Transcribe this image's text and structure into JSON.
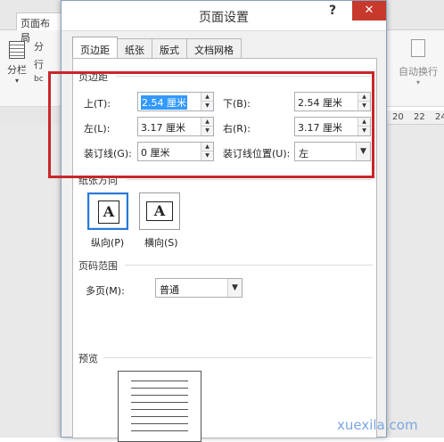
{
  "background": {
    "tab": "页面布局",
    "group1": "分栏",
    "group2_a": "分",
    "group2_b": "行",
    "group2_c": "bc",
    "right_group": "自动换行",
    "ruler": [
      "20",
      "22",
      "24"
    ]
  },
  "dialog": {
    "title": "页面设置",
    "help": "?",
    "close": "✕",
    "tabs": [
      "页边距",
      "纸张",
      "版式",
      "文档网格"
    ],
    "active_tab": "页边距",
    "margins": {
      "section_label": "页边距",
      "top_label": "上(T):",
      "top_value": "2.54 厘米",
      "bottom_label": "下(B):",
      "bottom_value": "2.54 厘米",
      "left_label": "左(L):",
      "left_value": "3.17 厘米",
      "right_label": "右(R):",
      "right_value": "3.17 厘米",
      "gutter_label": "装订线(G):",
      "gutter_value": "0 厘米",
      "gutter_pos_label": "装订线位置(U):",
      "gutter_pos_value": "左"
    },
    "orientation": {
      "section_label": "纸张方向",
      "portrait_label": "纵向(P)",
      "landscape_label": "横向(S)",
      "glyph": "A",
      "selected": "portrait"
    },
    "pages": {
      "section_label": "页码范围",
      "multi_label": "多页(M):",
      "multi_value": "普通"
    },
    "preview": {
      "section_label": "预览"
    }
  },
  "watermark": "xuexila.com",
  "colors": {
    "highlight": "#c8272a",
    "close": "#c7392c",
    "selection": "#3399ff",
    "watermark": "#7aa7e0"
  }
}
